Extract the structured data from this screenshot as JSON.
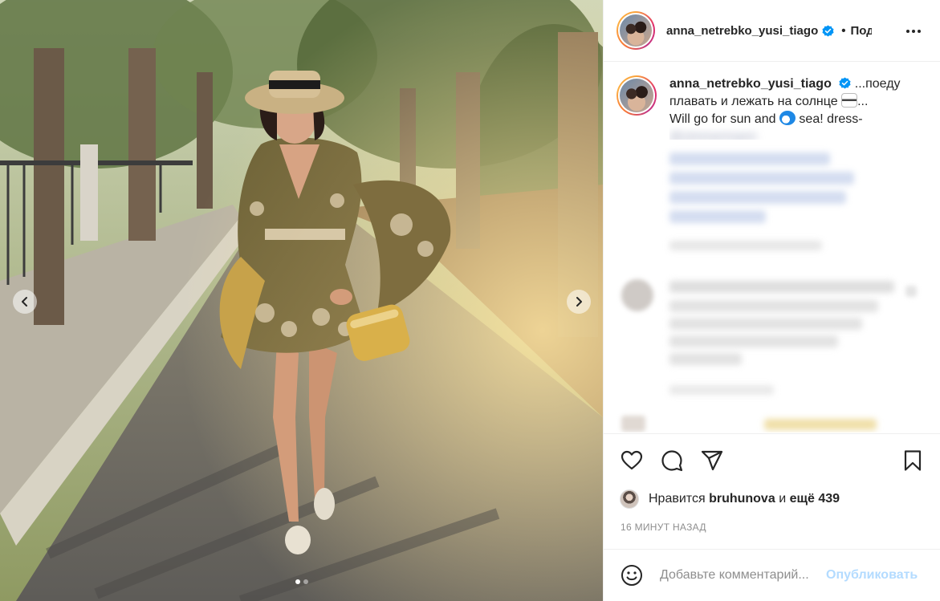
{
  "post": {
    "username": "anna_netrebko_yusi_tiago",
    "verified": true,
    "follow_separator": "•",
    "follow_label": "Подписаться",
    "more_icon": "more-horizontal-icon"
  },
  "caption": {
    "username": "anna_netrebko_yusi_tiago",
    "line1_rest": "...поеду",
    "line2": "плавать и лежать на солнце",
    "line2_end": "...",
    "line3_start": "Will go for sun and",
    "line3_end": "sea! dress-",
    "line4": "@zimmermann"
  },
  "carousel": {
    "total_slides": 2,
    "current_slide": 1,
    "prev_icon": "chevron-left-icon",
    "next_icon": "chevron-right-icon"
  },
  "actions": {
    "like_icon": "heart-icon",
    "comment_icon": "comment-icon",
    "share_icon": "paper-plane-icon",
    "save_icon": "bookmark-icon"
  },
  "likes": {
    "prefix": "Нравится",
    "user": "bruhunova",
    "conjunction": "и",
    "others": "ещё 439"
  },
  "timestamp": "16 МИНУТ НАЗАД",
  "comment_box": {
    "placeholder": "Добавьте комментарий...",
    "publish_label": "Опубликовать",
    "emoji_icon": "smile-icon"
  },
  "colors": {
    "verified_blue": "#0095f6",
    "publish_disabled": "#b3dbff",
    "muted_text": "#8e8e8e",
    "border": "#efefef"
  }
}
